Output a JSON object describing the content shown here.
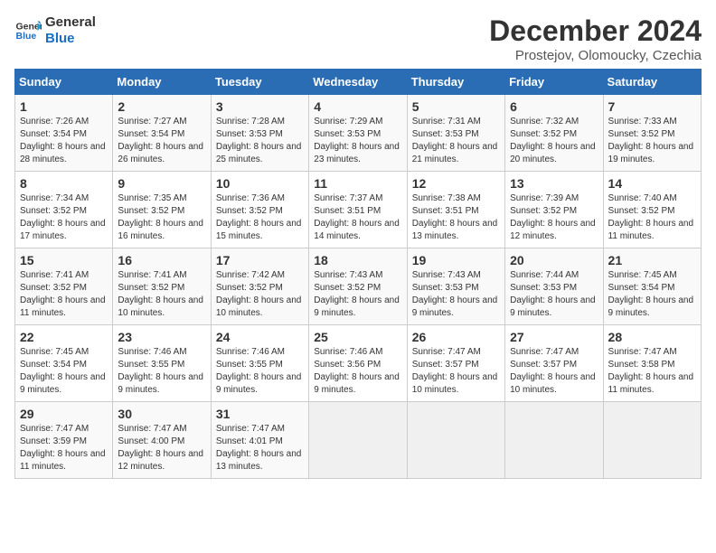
{
  "logo": {
    "line1": "General",
    "line2": "Blue"
  },
  "title": "December 2024",
  "subtitle": "Prostejov, Olomoucky, Czechia",
  "days_header": [
    "Sunday",
    "Monday",
    "Tuesday",
    "Wednesday",
    "Thursday",
    "Friday",
    "Saturday"
  ],
  "weeks": [
    [
      {
        "day": "1",
        "sunrise": "Sunrise: 7:26 AM",
        "sunset": "Sunset: 3:54 PM",
        "daylight": "Daylight: 8 hours and 28 minutes."
      },
      {
        "day": "2",
        "sunrise": "Sunrise: 7:27 AM",
        "sunset": "Sunset: 3:54 PM",
        "daylight": "Daylight: 8 hours and 26 minutes."
      },
      {
        "day": "3",
        "sunrise": "Sunrise: 7:28 AM",
        "sunset": "Sunset: 3:53 PM",
        "daylight": "Daylight: 8 hours and 25 minutes."
      },
      {
        "day": "4",
        "sunrise": "Sunrise: 7:29 AM",
        "sunset": "Sunset: 3:53 PM",
        "daylight": "Daylight: 8 hours and 23 minutes."
      },
      {
        "day": "5",
        "sunrise": "Sunrise: 7:31 AM",
        "sunset": "Sunset: 3:53 PM",
        "daylight": "Daylight: 8 hours and 21 minutes."
      },
      {
        "day": "6",
        "sunrise": "Sunrise: 7:32 AM",
        "sunset": "Sunset: 3:52 PM",
        "daylight": "Daylight: 8 hours and 20 minutes."
      },
      {
        "day": "7",
        "sunrise": "Sunrise: 7:33 AM",
        "sunset": "Sunset: 3:52 PM",
        "daylight": "Daylight: 8 hours and 19 minutes."
      }
    ],
    [
      {
        "day": "8",
        "sunrise": "Sunrise: 7:34 AM",
        "sunset": "Sunset: 3:52 PM",
        "daylight": "Daylight: 8 hours and 17 minutes."
      },
      {
        "day": "9",
        "sunrise": "Sunrise: 7:35 AM",
        "sunset": "Sunset: 3:52 PM",
        "daylight": "Daylight: 8 hours and 16 minutes."
      },
      {
        "day": "10",
        "sunrise": "Sunrise: 7:36 AM",
        "sunset": "Sunset: 3:52 PM",
        "daylight": "Daylight: 8 hours and 15 minutes."
      },
      {
        "day": "11",
        "sunrise": "Sunrise: 7:37 AM",
        "sunset": "Sunset: 3:51 PM",
        "daylight": "Daylight: 8 hours and 14 minutes."
      },
      {
        "day": "12",
        "sunrise": "Sunrise: 7:38 AM",
        "sunset": "Sunset: 3:51 PM",
        "daylight": "Daylight: 8 hours and 13 minutes."
      },
      {
        "day": "13",
        "sunrise": "Sunrise: 7:39 AM",
        "sunset": "Sunset: 3:52 PM",
        "daylight": "Daylight: 8 hours and 12 minutes."
      },
      {
        "day": "14",
        "sunrise": "Sunrise: 7:40 AM",
        "sunset": "Sunset: 3:52 PM",
        "daylight": "Daylight: 8 hours and 11 minutes."
      }
    ],
    [
      {
        "day": "15",
        "sunrise": "Sunrise: 7:41 AM",
        "sunset": "Sunset: 3:52 PM",
        "daylight": "Daylight: 8 hours and 11 minutes."
      },
      {
        "day": "16",
        "sunrise": "Sunrise: 7:41 AM",
        "sunset": "Sunset: 3:52 PM",
        "daylight": "Daylight: 8 hours and 10 minutes."
      },
      {
        "day": "17",
        "sunrise": "Sunrise: 7:42 AM",
        "sunset": "Sunset: 3:52 PM",
        "daylight": "Daylight: 8 hours and 10 minutes."
      },
      {
        "day": "18",
        "sunrise": "Sunrise: 7:43 AM",
        "sunset": "Sunset: 3:52 PM",
        "daylight": "Daylight: 8 hours and 9 minutes."
      },
      {
        "day": "19",
        "sunrise": "Sunrise: 7:43 AM",
        "sunset": "Sunset: 3:53 PM",
        "daylight": "Daylight: 8 hours and 9 minutes."
      },
      {
        "day": "20",
        "sunrise": "Sunrise: 7:44 AM",
        "sunset": "Sunset: 3:53 PM",
        "daylight": "Daylight: 8 hours and 9 minutes."
      },
      {
        "day": "21",
        "sunrise": "Sunrise: 7:45 AM",
        "sunset": "Sunset: 3:54 PM",
        "daylight": "Daylight: 8 hours and 9 minutes."
      }
    ],
    [
      {
        "day": "22",
        "sunrise": "Sunrise: 7:45 AM",
        "sunset": "Sunset: 3:54 PM",
        "daylight": "Daylight: 8 hours and 9 minutes."
      },
      {
        "day": "23",
        "sunrise": "Sunrise: 7:46 AM",
        "sunset": "Sunset: 3:55 PM",
        "daylight": "Daylight: 8 hours and 9 minutes."
      },
      {
        "day": "24",
        "sunrise": "Sunrise: 7:46 AM",
        "sunset": "Sunset: 3:55 PM",
        "daylight": "Daylight: 8 hours and 9 minutes."
      },
      {
        "day": "25",
        "sunrise": "Sunrise: 7:46 AM",
        "sunset": "Sunset: 3:56 PM",
        "daylight": "Daylight: 8 hours and 9 minutes."
      },
      {
        "day": "26",
        "sunrise": "Sunrise: 7:47 AM",
        "sunset": "Sunset: 3:57 PM",
        "daylight": "Daylight: 8 hours and 10 minutes."
      },
      {
        "day": "27",
        "sunrise": "Sunrise: 7:47 AM",
        "sunset": "Sunset: 3:57 PM",
        "daylight": "Daylight: 8 hours and 10 minutes."
      },
      {
        "day": "28",
        "sunrise": "Sunrise: 7:47 AM",
        "sunset": "Sunset: 3:58 PM",
        "daylight": "Daylight: 8 hours and 11 minutes."
      }
    ],
    [
      {
        "day": "29",
        "sunrise": "Sunrise: 7:47 AM",
        "sunset": "Sunset: 3:59 PM",
        "daylight": "Daylight: 8 hours and 11 minutes."
      },
      {
        "day": "30",
        "sunrise": "Sunrise: 7:47 AM",
        "sunset": "Sunset: 4:00 PM",
        "daylight": "Daylight: 8 hours and 12 minutes."
      },
      {
        "day": "31",
        "sunrise": "Sunrise: 7:47 AM",
        "sunset": "Sunset: 4:01 PM",
        "daylight": "Daylight: 8 hours and 13 minutes."
      },
      null,
      null,
      null,
      null
    ]
  ]
}
